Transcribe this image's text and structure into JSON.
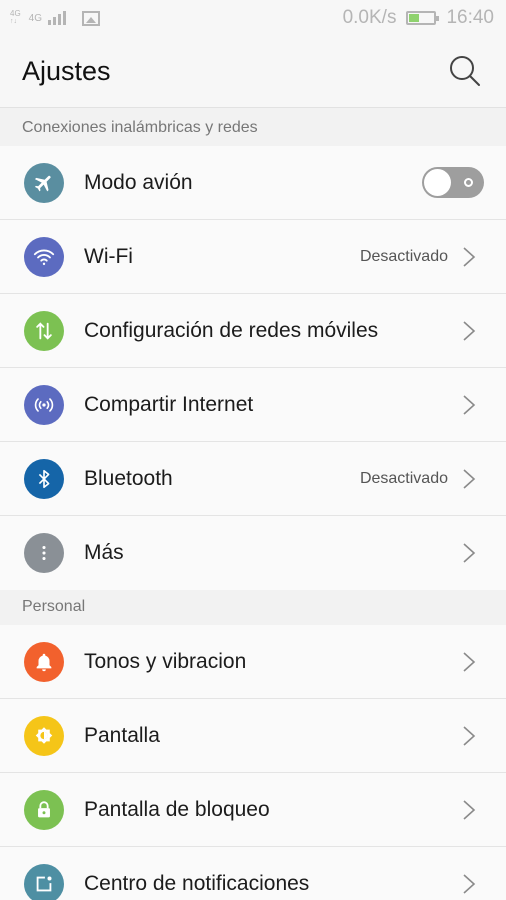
{
  "status_bar": {
    "signal_label_top": "4G",
    "signal_label_main": "4G",
    "speed": "0.0K/s",
    "time": "16:40",
    "icons": [
      "signal-icon",
      "gallery-icon",
      "battery-icon"
    ]
  },
  "header": {
    "title": "Ajustes"
  },
  "sections": [
    {
      "label": "Conexiones inalámbricas y redes",
      "items": [
        {
          "label": "Modo avión",
          "value": "",
          "icon": "airplane-icon",
          "color": "#5a8ea0",
          "control": "toggle"
        },
        {
          "label": "Wi-Fi",
          "value": "Desactivado",
          "icon": "wifi-icon",
          "color": "#5c6bc0",
          "control": "chevron"
        },
        {
          "label": "Configuración de redes móviles",
          "value": "",
          "icon": "mobile-data-icon",
          "color": "#7cc152",
          "control": "chevron"
        },
        {
          "label": "Compartir Internet",
          "value": "",
          "icon": "hotspot-icon",
          "color": "#5c6bc0",
          "control": "chevron"
        },
        {
          "label": "Bluetooth",
          "value": "Desactivado",
          "icon": "bluetooth-icon",
          "color": "#1565a8",
          "control": "chevron"
        },
        {
          "label": "Más",
          "value": "",
          "icon": "more-icon",
          "color": "#8a9096",
          "control": "chevron"
        }
      ]
    },
    {
      "label": "Personal",
      "items": [
        {
          "label": "Tonos y vibracion",
          "value": "",
          "icon": "bell-icon",
          "color": "#f2612d",
          "control": "chevron"
        },
        {
          "label": "Pantalla",
          "value": "",
          "icon": "brightness-icon",
          "color": "#f5c518",
          "control": "chevron"
        },
        {
          "label": "Pantalla de bloqueo",
          "value": "",
          "icon": "lock-icon",
          "color": "#7cc152",
          "control": "chevron"
        },
        {
          "label": "Centro de notificaciones",
          "value": "",
          "icon": "notification-icon",
          "color": "#4e8fa3",
          "control": "chevron"
        }
      ]
    }
  ]
}
